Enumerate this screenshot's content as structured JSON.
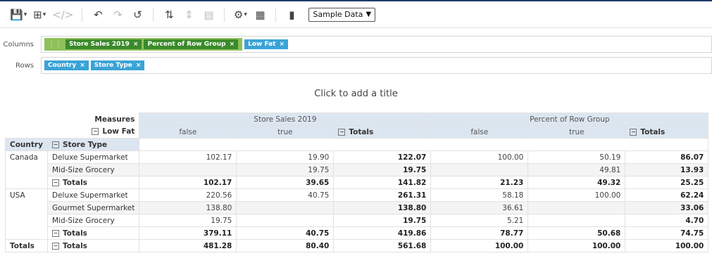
{
  "toolbar": {
    "select_value": "Sample Data"
  },
  "drop": {
    "columns_label": "Columns",
    "rows_label": "Rows",
    "columns": [
      "Store Sales 2019",
      "Percent of Row Group",
      "Low Fat"
    ],
    "rows": [
      "Country",
      "Store Type"
    ]
  },
  "title_placeholder": "Click to add a title",
  "pivot": {
    "measures_label": "Measures",
    "lowfat_label": "Low Fat",
    "store_sales": "Store Sales 2019",
    "percent": "Percent of Row Group",
    "false_label": "false",
    "true_label": "true",
    "totals_label": "Totals",
    "country_label": "Country",
    "store_type_label": "Store Type",
    "rows": [
      {
        "country": "Canada",
        "type": "Deluxe Supermarket",
        "v": [
          "102.17",
          "19.90",
          "122.07",
          "100.00",
          "50.19",
          "86.07"
        ]
      },
      {
        "country": "",
        "type": "Mid-Size Grocery",
        "v": [
          "",
          "19.75",
          "19.75",
          "",
          "49.81",
          "13.93"
        ]
      },
      {
        "country": "",
        "type": "Totals",
        "v": [
          "102.17",
          "39.65",
          "141.82",
          "21.23",
          "49.32",
          "25.25"
        ]
      },
      {
        "country": "USA",
        "type": "Deluxe Supermarket",
        "v": [
          "220.56",
          "40.75",
          "261.31",
          "58.18",
          "100.00",
          "62.24"
        ]
      },
      {
        "country": "",
        "type": "Gourmet Supermarket",
        "v": [
          "138.80",
          "",
          "138.80",
          "36.61",
          "",
          "33.06"
        ]
      },
      {
        "country": "",
        "type": "Mid-Size Grocery",
        "v": [
          "19.75",
          "",
          "19.75",
          "5.21",
          "",
          "4.70"
        ]
      },
      {
        "country": "",
        "type": "Totals",
        "v": [
          "379.11",
          "40.75",
          "419.86",
          "78.77",
          "50.68",
          "74.75"
        ]
      },
      {
        "country": "Totals",
        "type": "Totals",
        "v": [
          "481.28",
          "80.40",
          "561.68",
          "100.00",
          "100.00",
          "100.00"
        ]
      }
    ]
  }
}
